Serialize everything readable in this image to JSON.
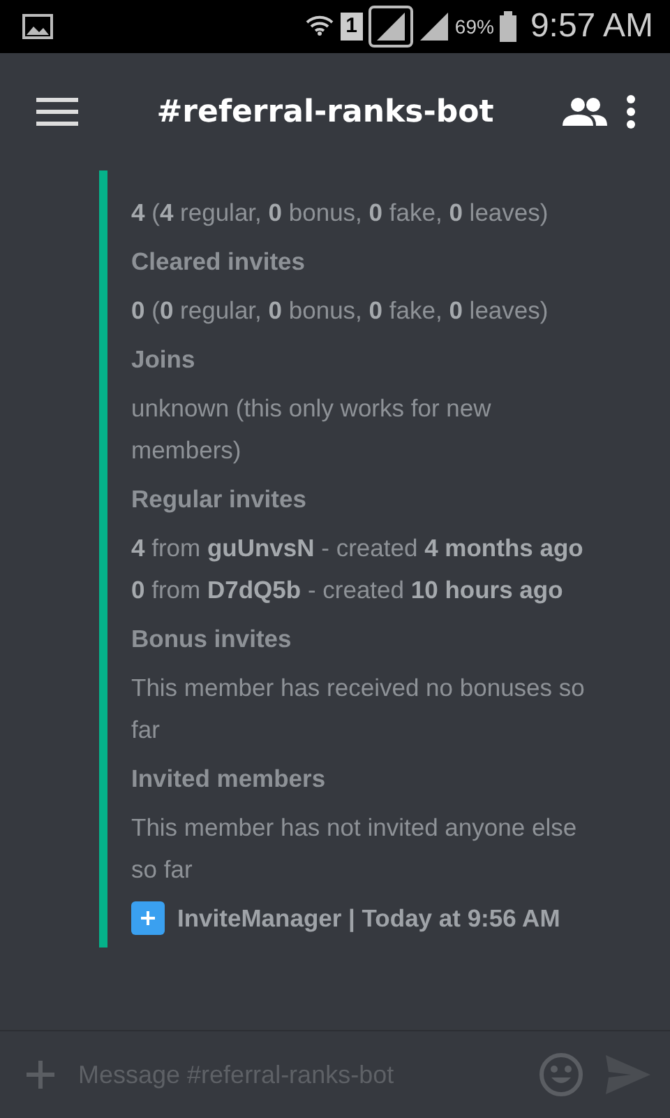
{
  "status_bar": {
    "sim": "1",
    "battery": "69%",
    "time": "9:57 AM"
  },
  "header": {
    "title": "#referral-ranks-bot"
  },
  "embed": {
    "lines": [
      {
        "kind": "value",
        "text": "**4** (**4** regular, **0** bonus, **0** fake, **0** leaves)"
      },
      {
        "kind": "title",
        "text": "Cleared invites"
      },
      {
        "kind": "value",
        "text": "**0** (**0** regular, **0** bonus, **0** fake, **0** leaves)"
      },
      {
        "kind": "title",
        "text": "Joins"
      },
      {
        "kind": "value",
        "text": "unknown (this only works for new\nmembers)"
      },
      {
        "kind": "title",
        "text": "Regular invites"
      },
      {
        "kind": "value",
        "text": "**4** from **guUnvsN** - created **4 months ago**\n**0** from **D7dQ5b** - created **10 hours ago**"
      },
      {
        "kind": "title",
        "text": "Bonus invites"
      },
      {
        "kind": "value",
        "text": "This member has received no bonuses so\nfar"
      },
      {
        "kind": "title",
        "text": "Invited members"
      },
      {
        "kind": "value",
        "text": "This member has not invited anyone else\nso far"
      }
    ],
    "footer": "InviteManager | Today at 9:56 AM"
  },
  "composer": {
    "placeholder": "Message #referral-ranks-bot"
  }
}
